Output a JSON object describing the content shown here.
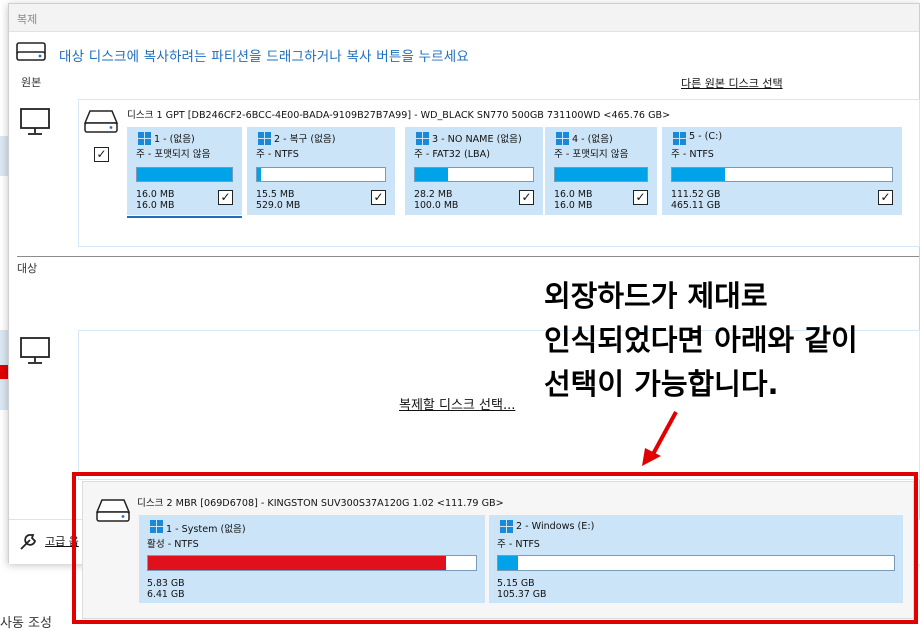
{
  "window": {
    "title": "복제",
    "instruction": "대상 디스크에 복사하려는 파티션을 드래그하거나 복사 버튼을 누르세요"
  },
  "source": {
    "label": "원본",
    "other_source_link": "다른 원본 디스크 선택",
    "disk_checked": true,
    "disk_info": "디스크 1 GPT [DB246CF2-6BCC-4E00-BADA-9109B27B7A99] - WD_BLACK SN770 500GB 731100WD  <465.76 GB>",
    "partitions": [
      {
        "name": "1 - (없음)",
        "type": "주 - 포맷되지 않음",
        "used": "16.0 MB",
        "total": "16.0 MB",
        "fill": 1.0,
        "checked": true
      },
      {
        "name": "2 - 복구 (없음)",
        "type": "주 - NTFS",
        "used": "15.5 MB",
        "total": "529.0 MB",
        "fill": 0.03,
        "checked": true
      },
      {
        "name": "3 - NO NAME (없음)",
        "type": "주 - FAT32 (LBA)",
        "used": "28.2 MB",
        "total": "100.0 MB",
        "fill": 0.28,
        "checked": true
      },
      {
        "name": "4 - (없음)",
        "type": "주 - 포맷되지 않음",
        "used": "16.0 MB",
        "total": "16.0 MB",
        "fill": 1.0,
        "checked": true
      },
      {
        "name": "5 - (C:)",
        "type": "주 - NTFS",
        "used": "111.52 GB",
        "total": "465.11 GB",
        "fill": 0.24,
        "checked": true
      }
    ]
  },
  "destination": {
    "label": "대상",
    "select_link": "복제할 디스크 선택..."
  },
  "footer": {
    "advanced_label": "고급 옵"
  },
  "annotation": {
    "text": "외장하드가 제대로\n인식되었다면 아래와 같이\n선택이 가능합니다."
  },
  "overlay_disk": {
    "info": "디스크 2 MBR [069D6708] - KINGSTON  SUV300S37A120G  1.02  <111.79 GB>",
    "partitions": [
      {
        "name": "1 - System (없음)",
        "type": "활성 - NTFS",
        "used": "5.83 GB",
        "total": "6.41 GB",
        "fill": 0.91,
        "color": "#e0101c"
      },
      {
        "name": "2 - Windows (E:)",
        "type": "주 - NTFS",
        "used": "5.15 GB",
        "total": "105.37 GB",
        "fill": 0.05,
        "color": "#00a2e8"
      }
    ]
  },
  "background": {
    "partial_text": "사동 조성"
  },
  "colors": {
    "accent_blue": "#1e6fc0",
    "partition_bg": "#cce4f7",
    "usage_blue": "#00a2e8",
    "usage_red": "#e0101c",
    "highlight_red": "#e00000"
  }
}
